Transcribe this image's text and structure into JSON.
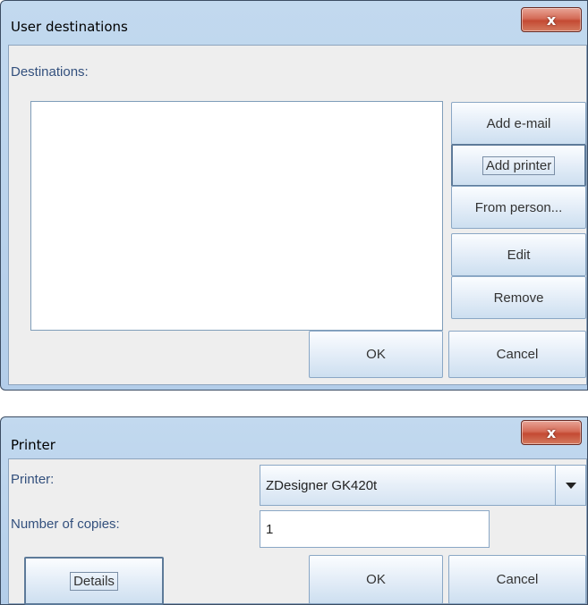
{
  "dialogs": {
    "user_destinations": {
      "title": "User destinations",
      "close_glyph": "x",
      "destinations_label": "Destinations:",
      "destinations": [],
      "buttons": {
        "add_email": "Add e-mail",
        "add_printer": "Add printer",
        "from_person": "From person...",
        "edit": "Edit",
        "remove": "Remove",
        "ok": "OK",
        "cancel": "Cancel"
      }
    },
    "printer": {
      "title": "Printer",
      "close_glyph": "x",
      "printer_label": "Printer:",
      "printer_value": "ZDesigner GK420t",
      "copies_label": "Number of copies:",
      "copies_value": "1",
      "buttons": {
        "details": "Details",
        "ok": "OK",
        "cancel": "Cancel"
      }
    }
  },
  "colors": {
    "title_bar": "#b8d1eb",
    "close_button": "#c94a32",
    "label_text": "#33507d"
  }
}
